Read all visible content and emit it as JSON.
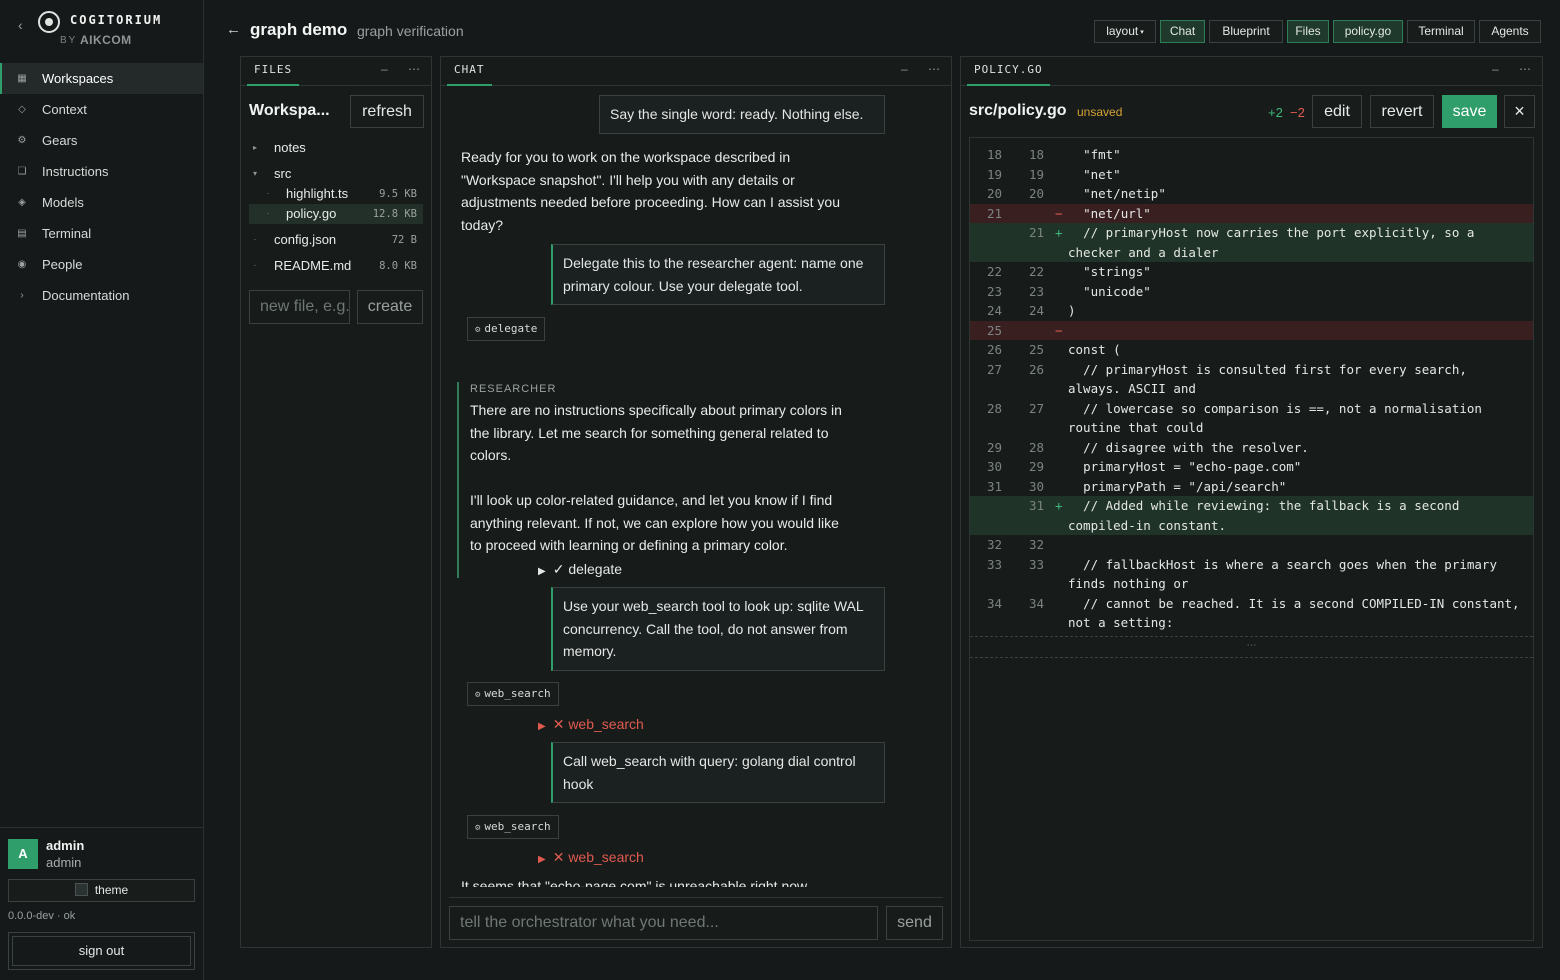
{
  "brand": {
    "name": "COGITORIUM",
    "by": "BY",
    "maker": "AIKCOM"
  },
  "nav": [
    {
      "label": "Workspaces",
      "icon": "grid-icon",
      "glyph": "▦",
      "active": true
    },
    {
      "label": "Context",
      "icon": "diamond-icon",
      "glyph": "◇"
    },
    {
      "label": "Gears",
      "icon": "gear-icon",
      "glyph": "⚙"
    },
    {
      "label": "Instructions",
      "icon": "document-icon",
      "glyph": "❏"
    },
    {
      "label": "Models",
      "icon": "cube-icon",
      "glyph": "◈"
    },
    {
      "label": "Terminal",
      "icon": "terminal-icon",
      "glyph": "▤"
    },
    {
      "label": "People",
      "icon": "people-icon",
      "glyph": "◉"
    },
    {
      "label": "Documentation",
      "icon": "chevron-right-icon",
      "glyph": "›"
    }
  ],
  "user": {
    "initial": "A",
    "name": "admin",
    "role": "admin",
    "theme_label": "theme",
    "version": "0.0.0-dev · ok",
    "signout_label": "sign out"
  },
  "header": {
    "title": "graph demo",
    "subtitle": "graph verification",
    "tabs": [
      {
        "label": "layout",
        "caret": "▾",
        "active": false
      },
      {
        "label": "Chat",
        "active": true
      },
      {
        "label": "Blueprint",
        "active": false
      },
      {
        "label": "Files",
        "active": true
      },
      {
        "label": "policy.go",
        "active": true
      },
      {
        "label": "Terminal",
        "active": false
      },
      {
        "label": "Agents",
        "active": false
      }
    ]
  },
  "files": {
    "panel_label": "FILES",
    "title": "Workspa...",
    "refresh_label": "refresh",
    "tree": [
      {
        "name": "notes",
        "twist": "▸",
        "size": ""
      },
      {
        "name": "src",
        "twist": "▾",
        "size": ""
      },
      {
        "name": "highlight.ts",
        "twist": "·",
        "size": "9.5 KB",
        "child": true
      },
      {
        "name": "policy.go",
        "twist": "·",
        "size": "12.8 KB",
        "child": true,
        "selected": true
      },
      {
        "name": "config.json",
        "twist": "·",
        "size": "72 B"
      },
      {
        "name": "README.md",
        "twist": "·",
        "size": "8.0 KB"
      }
    ],
    "new_file_placeholder": "new file, e.g.",
    "create_label": "create"
  },
  "chat": {
    "panel_label": "CHAT",
    "user_msg_1": "Say the single word: ready. Nothing else.",
    "assistant_msg_1": "Ready for you to work on the workspace described in \"Workspace snapshot\". I'll help you with any details or adjustments needed before proceeding. How can I assist you today?",
    "user_msg_2": "Delegate this to the researcher agent: name one primary colour. Use your delegate tool.",
    "tool_1": "delegate",
    "researcher_label": "RESEARCHER",
    "researcher_msg": "There are no instructions specifically about primary colors in the library. Let me search for something general related to colors.\n\nI'll look up color-related guidance, and let you know if I find anything relevant. If not, we can explore how you would like to proceed with learning or defining a primary color.",
    "status_1": "✓ delegate",
    "user_msg_3": "Use your web_search tool to look up: sqlite WAL concurrency. Call the tool, do not answer from memory.",
    "tool_2": "web_search",
    "status_2": "✕ web_search",
    "user_msg_4": "Call web_search with query: golang dial control hook",
    "tool_3": "web_search",
    "status_3": "✕ web_search",
    "truncated_msg": "It seems that \"echo-page.com\" is unreachable right now.",
    "input_placeholder": "tell the orchestrator what you need...",
    "send_label": "send"
  },
  "editor": {
    "panel_label": "POLICY.GO",
    "path": "src/policy.go",
    "state": "unsaved",
    "added": "+2",
    "removed": "−2",
    "edit_label": "edit",
    "revert_label": "revert",
    "save_label": "save",
    "close_label": "×",
    "fold_label": "⋯",
    "lines": [
      {
        "old": "18",
        "new": "18",
        "mark": "",
        "type": "ctx",
        "text": "  \"fmt\""
      },
      {
        "old": "19",
        "new": "19",
        "mark": "",
        "type": "ctx",
        "text": "  \"net\""
      },
      {
        "old": "20",
        "new": "20",
        "mark": "",
        "type": "ctx",
        "text": "  \"net/netip\""
      },
      {
        "old": "21",
        "new": "",
        "mark": "−",
        "type": "del",
        "text": "  \"net/url\""
      },
      {
        "old": "",
        "new": "21",
        "mark": "+",
        "type": "add",
        "text": "  // primaryHost now carries the port explicitly, so a checker and a dialer"
      },
      {
        "old": "22",
        "new": "22",
        "mark": "",
        "type": "ctx",
        "text": "  \"strings\""
      },
      {
        "old": "23",
        "new": "23",
        "mark": "",
        "type": "ctx",
        "text": "  \"unicode\""
      },
      {
        "old": "24",
        "new": "24",
        "mark": "",
        "type": "ctx",
        "text": ")"
      },
      {
        "old": "25",
        "new": "",
        "mark": "−",
        "type": "del",
        "text": ""
      },
      {
        "old": "26",
        "new": "25",
        "mark": "",
        "type": "ctx",
        "text": "const ("
      },
      {
        "old": "27",
        "new": "26",
        "mark": "",
        "type": "ctx",
        "text": "  // primaryHost is consulted first for every search, always. ASCII and"
      },
      {
        "old": "28",
        "new": "27",
        "mark": "",
        "type": "ctx",
        "text": "  // lowercase so comparison is ==, not a normalisation routine that could"
      },
      {
        "old": "29",
        "new": "28",
        "mark": "",
        "type": "ctx",
        "text": "  // disagree with the resolver."
      },
      {
        "old": "30",
        "new": "29",
        "mark": "",
        "type": "ctx",
        "text": "  primaryHost = \"echo-page.com\""
      },
      {
        "old": "31",
        "new": "30",
        "mark": "",
        "type": "ctx",
        "text": "  primaryPath = \"/api/search\""
      },
      {
        "old": "",
        "new": "31",
        "mark": "+",
        "type": "add",
        "text": "  // Added while reviewing: the fallback is a second compiled-in constant."
      },
      {
        "old": "32",
        "new": "32",
        "mark": "",
        "type": "ctx",
        "text": ""
      },
      {
        "old": "33",
        "new": "33",
        "mark": "",
        "type": "ctx",
        "text": "  // fallbackHost is where a search goes when the primary finds nothing or"
      },
      {
        "old": "34",
        "new": "34",
        "mark": "",
        "type": "ctx",
        "text": "  // cannot be reached. It is a second COMPILED-IN constant, not a setting:"
      }
    ]
  }
}
